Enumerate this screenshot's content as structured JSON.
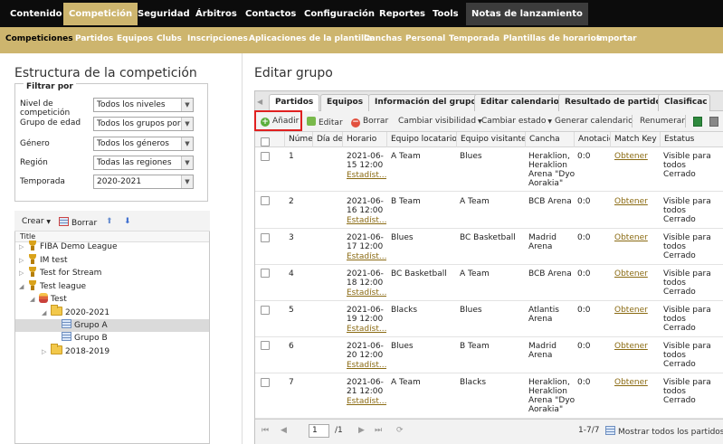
{
  "topnav": {
    "items": [
      "Contenido",
      "Competición",
      "Seguridad",
      "Árbitros",
      "Contactos",
      "Configuración",
      "Reportes",
      "Tools",
      "Notas de lanzamiento"
    ],
    "active_index": 1
  },
  "subnav": {
    "items": [
      "Competiciones",
      "Partidos",
      "Equipos",
      "Clubs",
      "Inscripciones",
      "Aplicaciones de la plantilla",
      "Canchas",
      "Personal",
      "Temporada",
      "Plantillas de horarios",
      "Importar"
    ],
    "active_index": 0
  },
  "left": {
    "title": "Estructura de la competición",
    "filter": {
      "legend": "Filtrar por",
      "fields": [
        {
          "label": "Nivel de\ncompetición",
          "value": "Todos los niveles"
        },
        {
          "label": "Grupo de edad",
          "value": "Todos los grupos por"
        },
        {
          "label": "Género",
          "value": "Todos los géneros"
        },
        {
          "label": "Región",
          "value": "Todas las regiones"
        },
        {
          "label": "Temporada",
          "value": "2020-2021"
        }
      ]
    },
    "tree": {
      "create_label": "Crear",
      "delete_label": "Borrar",
      "header": "Title",
      "nodes": [
        {
          "label": "FIBA Demo League",
          "icon": "trophy-icon"
        },
        {
          "label": "IM test",
          "icon": "trophy-icon"
        },
        {
          "label": "Test for Stream",
          "icon": "trophy-icon"
        },
        {
          "label": "Test league",
          "icon": "trophy-icon"
        },
        {
          "label": "Test",
          "icon": "stack-icon"
        },
        {
          "label": "2020-2021",
          "icon": "folder-icon"
        },
        {
          "label": "Grupo A",
          "icon": "grid-icon"
        },
        {
          "label": "Grupo B",
          "icon": "grid-icon"
        },
        {
          "label": "2018-2019",
          "icon": "folder-icon"
        }
      ]
    }
  },
  "right": {
    "title": "Editar grupo",
    "tabs": [
      "Partidos",
      "Equipos",
      "Información del grupo",
      "Editar calendario",
      "Resultado de partido",
      "Clasificac"
    ],
    "active_tab": 0,
    "toolbar": {
      "add": "Añadir",
      "edit": "Editar",
      "delete": "Borrar",
      "visibility": "Cambiar visibilidad",
      "status": "Cambiar estado",
      "calendar": "Generar calendario",
      "renumber": "Renumerar"
    },
    "columns": [
      "Númer",
      "Día de",
      "Horario",
      "Equipo locatario",
      "Equipo visitante",
      "Cancha",
      "Anotació",
      "Match Key",
      "Estatus"
    ],
    "rows": [
      {
        "num": "1",
        "date": "2021-06-\n15 12:00",
        "stats": "Estadíst...",
        "home": "A Team",
        "away": "Blues",
        "venue": "Heraklion,\nHeraklion\nArena \"Dyo\nAorakia\"",
        "score": "0:0",
        "key": "Obtener",
        "status": "Visible para\ntodos\nCerrado"
      },
      {
        "num": "2",
        "date": "2021-06-\n16 12:00",
        "stats": "Estadíst...",
        "home": "B Team",
        "away": "A Team",
        "venue": "BCB Arena",
        "score": "0:0",
        "key": "Obtener",
        "status": "Visible para\ntodos\nCerrado"
      },
      {
        "num": "3",
        "date": "2021-06-\n17 12:00",
        "stats": "Estadíst...",
        "home": "Blues",
        "away": "BC Basketball",
        "venue": "Madrid\nArena",
        "score": "0:0",
        "key": "Obtener",
        "status": "Visible para\ntodos\nCerrado"
      },
      {
        "num": "4",
        "date": "2021-06-\n18 12:00",
        "stats": "Estadíst...",
        "home": "BC Basketball",
        "away": "A Team",
        "venue": "BCB Arena",
        "score": "0:0",
        "key": "Obtener",
        "status": "Visible para\ntodos\nCerrado"
      },
      {
        "num": "5",
        "date": "2021-06-\n19 12:00",
        "stats": "Estadíst...",
        "home": "Blacks",
        "away": "Blues",
        "venue": "Atlantis\nArena",
        "score": "0:0",
        "key": "Obtener",
        "status": "Visible para\ntodos\nCerrado"
      },
      {
        "num": "6",
        "date": "2021-06-\n20 12:00",
        "stats": "Estadíst...",
        "home": "Blues",
        "away": "B Team",
        "venue": "Madrid\nArena",
        "score": "0:0",
        "key": "Obtener",
        "status": "Visible para\ntodos\nCerrado"
      },
      {
        "num": "7",
        "date": "2021-06-\n21 12:00",
        "stats": "Estadíst...",
        "home": "A Team",
        "away": "Blacks",
        "venue": "Heraklion,\nHeraklion\nArena \"Dyo\nAorakia\"",
        "score": "0:0",
        "key": "Obtener",
        "status": "Visible para\ntodos\nCerrado"
      }
    ],
    "pager": {
      "page": "1",
      "of": "/1",
      "range": "1-7/7",
      "show_all": "Mostrar todos los partidos"
    }
  },
  "colors": {
    "accent": "#cdb56e",
    "nav_bg": "#0c0c0c",
    "highlight": "#e02020",
    "link": "#8a6a12"
  }
}
